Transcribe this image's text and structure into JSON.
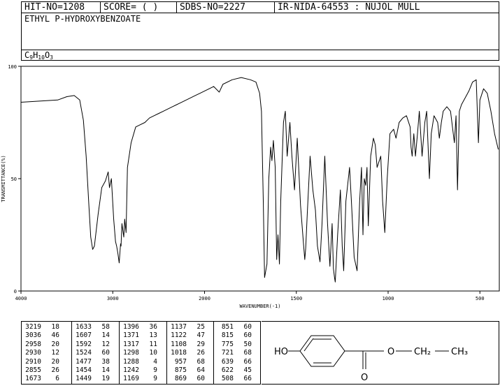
{
  "header": {
    "hit_no": "HIT-NO=1208",
    "score": "SCORE=  (    )",
    "sdbs_no": "SDBS-NO=2227",
    "ir_id": "IR-NIDA-64553 : NUJOL MULL",
    "compound": "ETHYL P-HYDROXYBENZOATE",
    "formula_parts": [
      "C",
      "9",
      "H",
      "10",
      "O",
      "3"
    ]
  },
  "chart_data": {
    "type": "line",
    "xlabel": "WAVENUMBER(-1)",
    "ylabel": "TRANSMITTANCE(%)",
    "xlim": [
      4000,
      400
    ],
    "ylim": [
      0,
      100
    ],
    "x_ticks": [
      4000,
      3000,
      2000,
      1500,
      1000,
      500
    ],
    "y_ticks": [
      0,
      50,
      100
    ],
    "grid": false,
    "series": [
      {
        "points": [
          [
            4000,
            84
          ],
          [
            3800,
            84.5
          ],
          [
            3600,
            85
          ],
          [
            3500,
            86.5
          ],
          [
            3420,
            87
          ],
          [
            3360,
            85
          ],
          [
            3320,
            76
          ],
          [
            3290,
            60
          ],
          [
            3260,
            38
          ],
          [
            3240,
            24
          ],
          [
            3219,
            18.5
          ],
          [
            3200,
            20
          ],
          [
            3160,
            34
          ],
          [
            3120,
            46
          ],
          [
            3080,
            49
          ],
          [
            3050,
            53
          ],
          [
            3036,
            46
          ],
          [
            3015,
            50
          ],
          [
            2990,
            32
          ],
          [
            2970,
            22
          ],
          [
            2958,
            20
          ],
          [
            2945,
            17
          ],
          [
            2930,
            12.5
          ],
          [
            2915,
            21
          ],
          [
            2910,
            20
          ],
          [
            2900,
            30
          ],
          [
            2880,
            24
          ],
          [
            2870,
            32
          ],
          [
            2855,
            26
          ],
          [
            2840,
            55
          ],
          [
            2800,
            66
          ],
          [
            2750,
            73
          ],
          [
            2700,
            74
          ],
          [
            2650,
            75
          ],
          [
            2600,
            77
          ],
          [
            2550,
            78
          ],
          [
            2500,
            79
          ],
          [
            2450,
            80
          ],
          [
            2400,
            81
          ],
          [
            2350,
            82
          ],
          [
            2300,
            83
          ],
          [
            2250,
            84
          ],
          [
            2200,
            85
          ],
          [
            2150,
            86
          ],
          [
            2100,
            87
          ],
          [
            2050,
            88
          ],
          [
            2000,
            89
          ],
          [
            1950,
            91
          ],
          [
            1920,
            88.5
          ],
          [
            1900,
            92
          ],
          [
            1850,
            94
          ],
          [
            1800,
            95
          ],
          [
            1750,
            94
          ],
          [
            1720,
            93
          ],
          [
            1700,
            88
          ],
          [
            1690,
            80
          ],
          [
            1680,
            40
          ],
          [
            1673,
            6
          ],
          [
            1660,
            12
          ],
          [
            1650,
            50
          ],
          [
            1640,
            64
          ],
          [
            1633,
            58
          ],
          [
            1625,
            67
          ],
          [
            1615,
            55
          ],
          [
            1607,
            14
          ],
          [
            1600,
            25
          ],
          [
            1592,
            12
          ],
          [
            1585,
            40
          ],
          [
            1570,
            75
          ],
          [
            1560,
            80
          ],
          [
            1550,
            60
          ],
          [
            1535,
            75
          ],
          [
            1524,
            60
          ],
          [
            1510,
            45
          ],
          [
            1495,
            68
          ],
          [
            1477,
            38
          ],
          [
            1460,
            20
          ],
          [
            1454,
            14
          ],
          [
            1449,
            19
          ],
          [
            1440,
            35
          ],
          [
            1425,
            60
          ],
          [
            1410,
            45
          ],
          [
            1396,
            36
          ],
          [
            1385,
            20
          ],
          [
            1371,
            13
          ],
          [
            1360,
            30
          ],
          [
            1345,
            60
          ],
          [
            1330,
            30
          ],
          [
            1317,
            11
          ],
          [
            1305,
            30
          ],
          [
            1298,
            10
          ],
          [
            1292,
            6
          ],
          [
            1288,
            4
          ],
          [
            1275,
            25
          ],
          [
            1260,
            45
          ],
          [
            1250,
            20
          ],
          [
            1242,
            9
          ],
          [
            1230,
            40
          ],
          [
            1210,
            55
          ],
          [
            1200,
            40
          ],
          [
            1185,
            15
          ],
          [
            1169,
            9
          ],
          [
            1155,
            40
          ],
          [
            1145,
            55
          ],
          [
            1137,
            25
          ],
          [
            1130,
            50
          ],
          [
            1122,
            47
          ],
          [
            1115,
            55
          ],
          [
            1108,
            29
          ],
          [
            1095,
            60
          ],
          [
            1080,
            68
          ],
          [
            1070,
            65
          ],
          [
            1060,
            55
          ],
          [
            1040,
            60
          ],
          [
            1030,
            40
          ],
          [
            1018,
            26
          ],
          [
            1005,
            50
          ],
          [
            990,
            70
          ],
          [
            970,
            72
          ],
          [
            957,
            68
          ],
          [
            940,
            75
          ],
          [
            920,
            77
          ],
          [
            900,
            78
          ],
          [
            880,
            73
          ],
          [
            875,
            64
          ],
          [
            869,
            60
          ],
          [
            860,
            70
          ],
          [
            851,
            60
          ],
          [
            840,
            70
          ],
          [
            830,
            80
          ],
          [
            815,
            60
          ],
          [
            800,
            75
          ],
          [
            790,
            80
          ],
          [
            775,
            50
          ],
          [
            765,
            70
          ],
          [
            750,
            78
          ],
          [
            730,
            75
          ],
          [
            721,
            68
          ],
          [
            710,
            75
          ],
          [
            700,
            80
          ],
          [
            680,
            82
          ],
          [
            660,
            80
          ],
          [
            639,
            66
          ],
          [
            630,
            78
          ],
          [
            622,
            45
          ],
          [
            612,
            80
          ],
          [
            600,
            83
          ],
          [
            580,
            86
          ],
          [
            560,
            89
          ],
          [
            540,
            93
          ],
          [
            520,
            94
          ],
          [
            508,
            66
          ],
          [
            500,
            85
          ],
          [
            480,
            90
          ],
          [
            460,
            88
          ],
          [
            440,
            80
          ],
          [
            420,
            70
          ],
          [
            400,
            63
          ]
        ]
      }
    ]
  },
  "peak_table": {
    "columns": [
      [
        [
          "3219",
          "18"
        ],
        [
          "3036",
          "46"
        ],
        [
          "2958",
          "20"
        ],
        [
          "2930",
          "12"
        ],
        [
          "2910",
          "20"
        ],
        [
          "2855",
          "26"
        ],
        [
          "1673",
          "6"
        ]
      ],
      [
        [
          "1633",
          "58"
        ],
        [
          "1607",
          "14"
        ],
        [
          "1592",
          "12"
        ],
        [
          "1524",
          "60"
        ],
        [
          "1477",
          "38"
        ],
        [
          "1454",
          "14"
        ],
        [
          "1449",
          "19"
        ]
      ],
      [
        [
          "1396",
          "36"
        ],
        [
          "1371",
          "13"
        ],
        [
          "1317",
          "11"
        ],
        [
          "1298",
          "10"
        ],
        [
          "1288",
          "4"
        ],
        [
          "1242",
          "9"
        ],
        [
          "1169",
          "9"
        ]
      ],
      [
        [
          "1137",
          "25"
        ],
        [
          "1122",
          "47"
        ],
        [
          "1108",
          "29"
        ],
        [
          "1018",
          "26"
        ],
        [
          "957",
          "68"
        ],
        [
          "875",
          "64"
        ],
        [
          "869",
          "60"
        ]
      ],
      [
        [
          "851",
          "60"
        ],
        [
          "815",
          "60"
        ],
        [
          "775",
          "50"
        ],
        [
          "721",
          "68"
        ],
        [
          "639",
          "66"
        ],
        [
          "622",
          "45"
        ],
        [
          "508",
          "66"
        ]
      ]
    ]
  },
  "structure": {
    "ho_label": "HO",
    "o_ester": "O",
    "o_carbonyl": "O",
    "ch2": "CH₂",
    "ch3": "CH₃"
  }
}
